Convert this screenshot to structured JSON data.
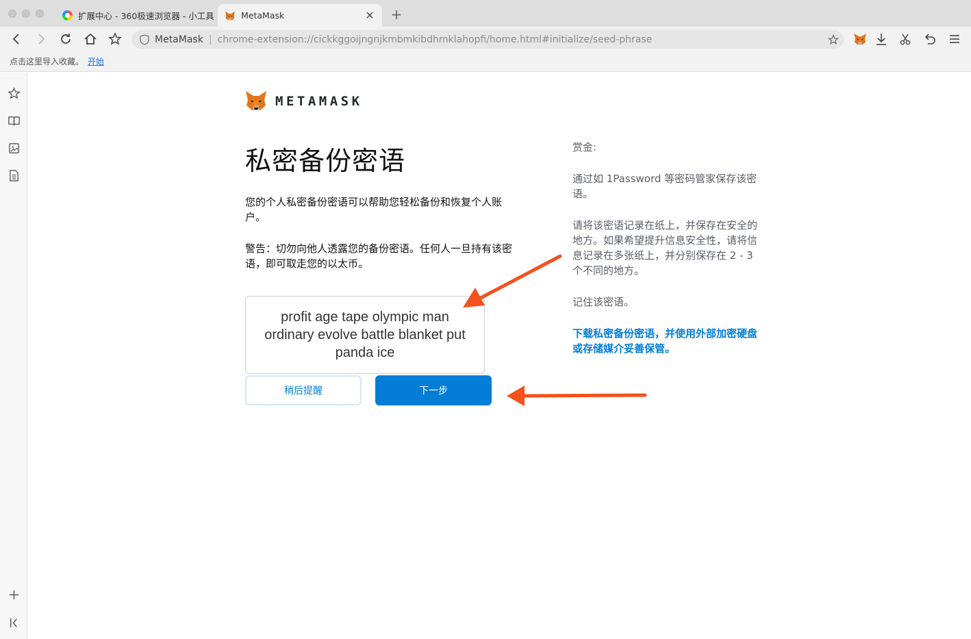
{
  "tabs": [
    {
      "title": "扩展中心 - 360极速浏览器 - 小工具",
      "icon": "360-browser-icon",
      "active": false
    },
    {
      "title": "MetaMask",
      "icon": "metamask-fox-icon",
      "active": true
    }
  ],
  "toolbar": {
    "site_name": "MetaMask",
    "url": "chrome-extension://cickkggoijngnjkmbmkibdhmklahopfi/home.html#initialize/seed-phrase"
  },
  "bookmarks_bar": {
    "prompt": "点击这里导入收藏。",
    "link": "开始"
  },
  "page": {
    "brand": "METAMASK",
    "title": "私密备份密语",
    "description": "您的个人私密备份密语可以帮助您轻松备份和恢复个人账户。",
    "warning": "警告：切勿向他人透露您的备份密语。任何人一旦持有该密语，即可取走您的以太币。",
    "seed_phrase": "profit age tape olympic man ordinary evolve battle blanket put panda ice",
    "remind_later_label": "稍后提醒",
    "next_label": "下一步"
  },
  "tips": {
    "heading": "赏金:",
    "tip1": "通过如 1Password 等密码管家保存该密语。",
    "tip2": "请将该密语记录在纸上，并保存在安全的地方。如果希望提升信息安全性，请将信息记录在多张纸上，并分别保存在 2 - 3 个不同的地方。",
    "tip3": "记住该密语。",
    "download_link": "下载私密备份密语，并使用外部加密硬盘或存储媒介妥善保管。"
  },
  "colors": {
    "primary": "#037dd6",
    "annotation_arrow": "#f4511e"
  }
}
